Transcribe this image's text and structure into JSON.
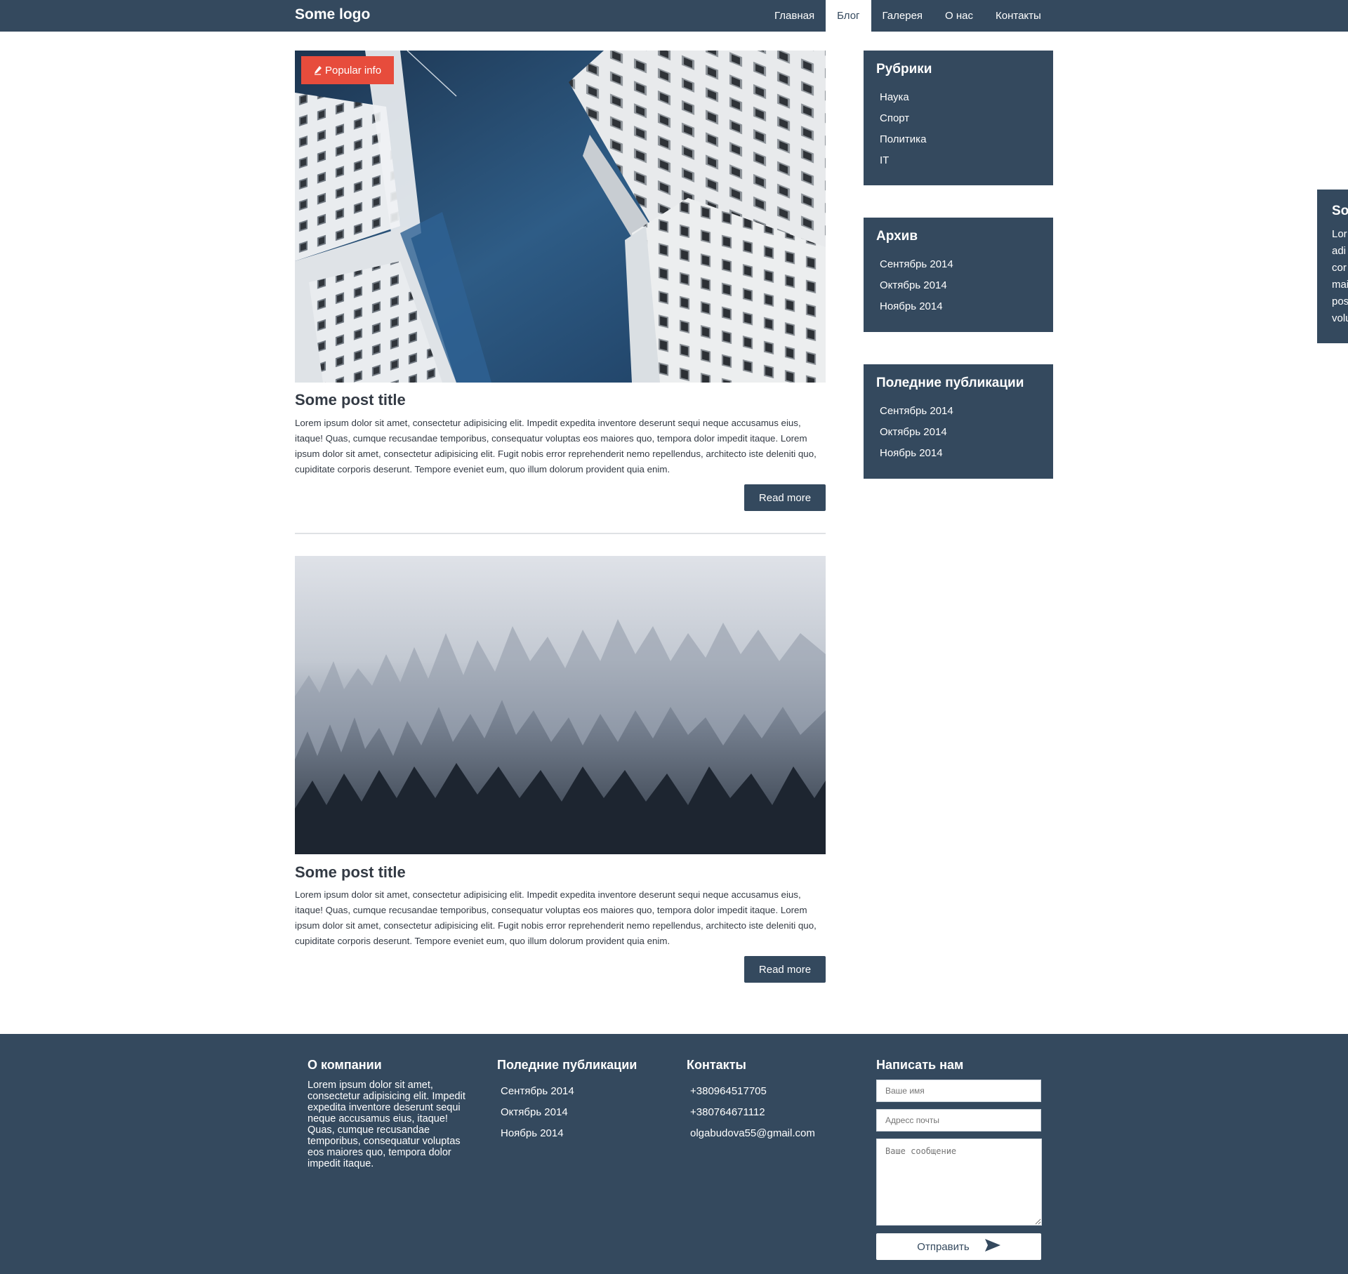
{
  "header": {
    "logo": "Some logo",
    "nav": [
      {
        "label": "Главная"
      },
      {
        "label": "Блог"
      },
      {
        "label": "Галерея"
      },
      {
        "label": "О нас"
      },
      {
        "label": "Контакты"
      }
    ],
    "active_nav": "Блог"
  },
  "posts": [
    {
      "badge": "Popular info",
      "title": "Some post title",
      "text": "Lorem ipsum dolor sit amet, consectetur adipisicing elit. Impedit expedita inventore deserunt sequi neque accusamus eius, itaque! Quas, cumque recusandae temporibus, consequatur voluptas eos maiores quo, tempora dolor impedit itaque. Lorem ipsum dolor sit amet, consectetur adipisicing elit. Fugit nobis error reprehenderit nemo repellendus, architecto iste deleniti quo, cupiditate corporis deserunt. Tempore eveniet eum, quo illum dolorum provident quia enim.",
      "button": "Read more"
    },
    {
      "title": "Some post title",
      "text": "Lorem ipsum dolor sit amet, consectetur adipisicing elit. Impedit expedita inventore deserunt sequi neque accusamus eius, itaque! Quas, cumque recusandae temporibus, consequatur voluptas eos maiores quo, tempora dolor impedit itaque. Lorem ipsum dolor sit amet, consectetur adipisicing elit. Fugit nobis error reprehenderit nemo repellendus, architecto iste deleniti quo, cupiditate corporis deserunt. Tempore eveniet eum, quo illum dolorum provident quia enim.",
      "button": "Read more"
    }
  ],
  "sidebar": {
    "categories": {
      "title": "Рубрики",
      "items": [
        "Наука",
        "Спорт",
        "Политика",
        "IT"
      ]
    },
    "archive": {
      "title": "Архив",
      "items": [
        "Сентябрь 2014",
        "Октябрь 2014",
        "Ноябрь 2014"
      ]
    },
    "recent": {
      "title": "Поледние публикации",
      "items": [
        "Сентябрь 2014",
        "Октябрь 2014",
        "Ноябрь 2014"
      ]
    }
  },
  "floating_panel": {
    "title_visible": "So",
    "lines_visible": [
      "Lor",
      "adi",
      "cor",
      "mai",
      "pos",
      "volu"
    ]
  },
  "footer": {
    "about": {
      "title": "О компании",
      "text": "Lorem ipsum dolor sit amet, consectetur adipisicing elit. Impedit expedita inventore deserunt sequi neque accusamus eius, itaque! Quas, cumque recusandae temporibus, consequatur voluptas eos maiores quo, tempora dolor impedit itaque."
    },
    "recent": {
      "title": "Поледние публикации",
      "items": [
        "Сентябрь 2014",
        "Октябрь 2014",
        "Ноябрь 2014"
      ]
    },
    "contacts": {
      "title": "Контакты",
      "items": [
        "+380964517705",
        "+380764671112",
        "olgabudova55@gmail.com"
      ]
    },
    "form": {
      "title": "Написать нам",
      "name_placeholder": "Ваше имя",
      "email_placeholder": "Адресс почты",
      "message_placeholder": "Ваше сообщение",
      "submit": "Отправить"
    }
  },
  "colors": {
    "primary": "#34495e",
    "badge": "#e74c3c",
    "text": "#333a44"
  },
  "icons": {
    "badge_icon": "pen-icon",
    "submit_icon": "send-icon"
  }
}
